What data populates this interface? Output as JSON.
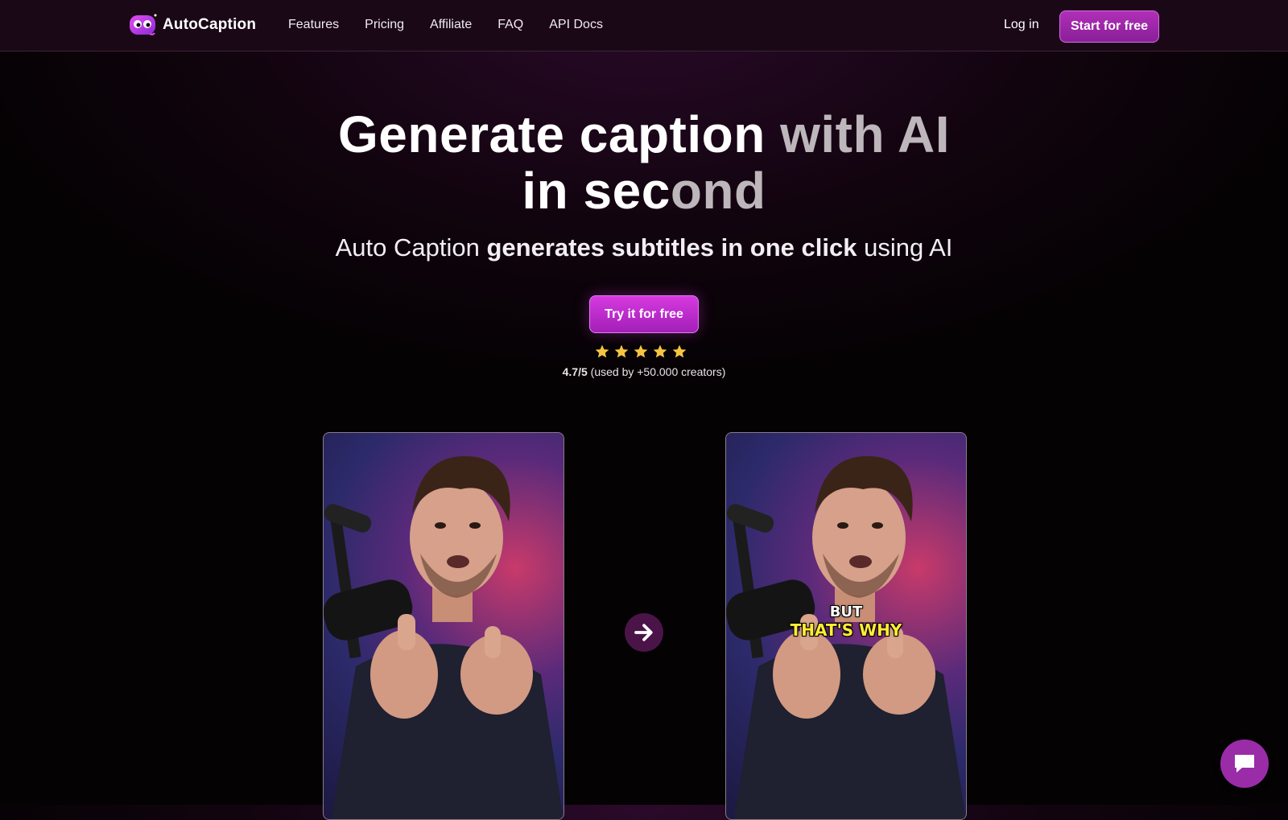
{
  "brand": {
    "name": "AutoCaption",
    "accent": "#b02fb7"
  },
  "nav": {
    "links": [
      "Features",
      "Pricing",
      "Affiliate",
      "FAQ",
      "API Docs"
    ],
    "login": "Log in",
    "start": "Start for free"
  },
  "hero": {
    "headline_line1_a": "Generate caption ",
    "headline_line1_b": "with AI",
    "headline_line2_a": "in sec",
    "headline_line2_b": "ond",
    "subtitle_a": "Auto Caption ",
    "subtitle_b": "generates subtitles in one click",
    "subtitle_c": " using AI",
    "cta": "Try it for free",
    "stars": 5,
    "rating_score": "4.7/5",
    "rating_text": " (used by +50.000 creators)"
  },
  "demo": {
    "caption_line1": "BUT",
    "caption_line2": "THAT'S WHY",
    "arrow_icon": "arrow-right-icon"
  },
  "chat": {
    "icon": "chat-icon"
  }
}
